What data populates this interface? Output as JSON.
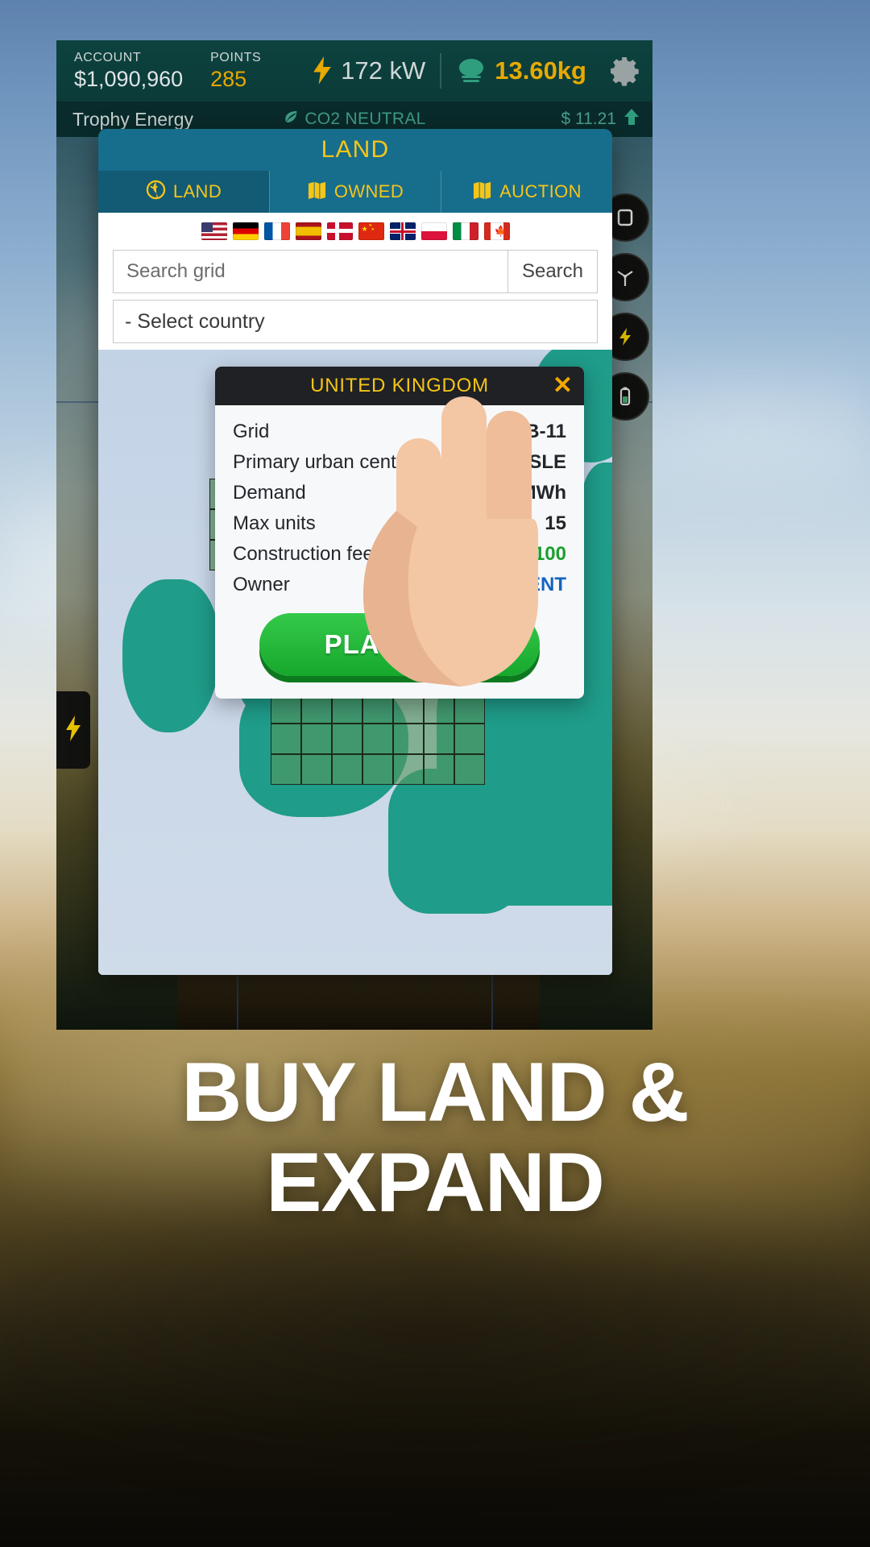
{
  "hud": {
    "account_label": "ACCOUNT",
    "account_value": "$1,090,960",
    "points_label": "POINTS",
    "points_value": "285",
    "power_value": "172 kW",
    "co2_weight": "13.60kg",
    "gear_icon": "gear-icon",
    "bolt_icon": "bolt-icon",
    "cloud_icon": "cloud-icon"
  },
  "subheader": {
    "company": "Trophy Energy",
    "co2_status": "CO2 NEUTRAL",
    "leaf_icon": "leaf-icon",
    "price": "$ 11.21",
    "trend_icon": "arrow-up-icon"
  },
  "panel": {
    "title": "LAND",
    "tabs": [
      {
        "label": "LAND",
        "icon": "globe-icon",
        "active": true
      },
      {
        "label": "OWNED",
        "icon": "map-icon",
        "active": false
      },
      {
        "label": "AUCTION",
        "icon": "map-icon",
        "active": false
      }
    ],
    "flags": [
      "united-states",
      "germany",
      "france",
      "spain",
      "denmark",
      "china",
      "united-kingdom",
      "poland",
      "italy",
      "canada"
    ],
    "search": {
      "placeholder": "Search grid",
      "value": "",
      "button_label": "Search"
    },
    "country_select": {
      "value": "- Select country"
    }
  },
  "card": {
    "title": "UNITED KINGDOM",
    "close_icon": "close-icon",
    "rows": [
      {
        "key": "Grid",
        "value": "GB-11",
        "style": "dark"
      },
      {
        "key": "Primary urban center",
        "value": "CARLISLE",
        "style": "dark"
      },
      {
        "key": "Demand",
        "value": "765.22 MWh",
        "style": "dark"
      },
      {
        "key": "Max units",
        "value": "15",
        "style": "dark"
      },
      {
        "key": "Construction fee",
        "value": "$100",
        "style": "green"
      },
      {
        "key": "Owner",
        "value": "GOVERNMENT",
        "style": "blue"
      }
    ],
    "bid_button": "PLACE BID"
  },
  "rail": {
    "buttons": [
      "building-icon",
      "wind-turbine-icon",
      "power-icon",
      "battery-icon"
    ],
    "left_tab_icon": "bolt-icon"
  },
  "caption": {
    "line1": "BUY LAND &",
    "line2": "EXPAND"
  },
  "colors": {
    "hud_bg": "#0d423f",
    "subhud_bg": "#0a2b2b",
    "panel_blue": "#176d8c",
    "gold": "#f5c518",
    "green_button": "#16a82c",
    "card_dark": "#1f2124",
    "selected_cell": "#c5d832"
  }
}
